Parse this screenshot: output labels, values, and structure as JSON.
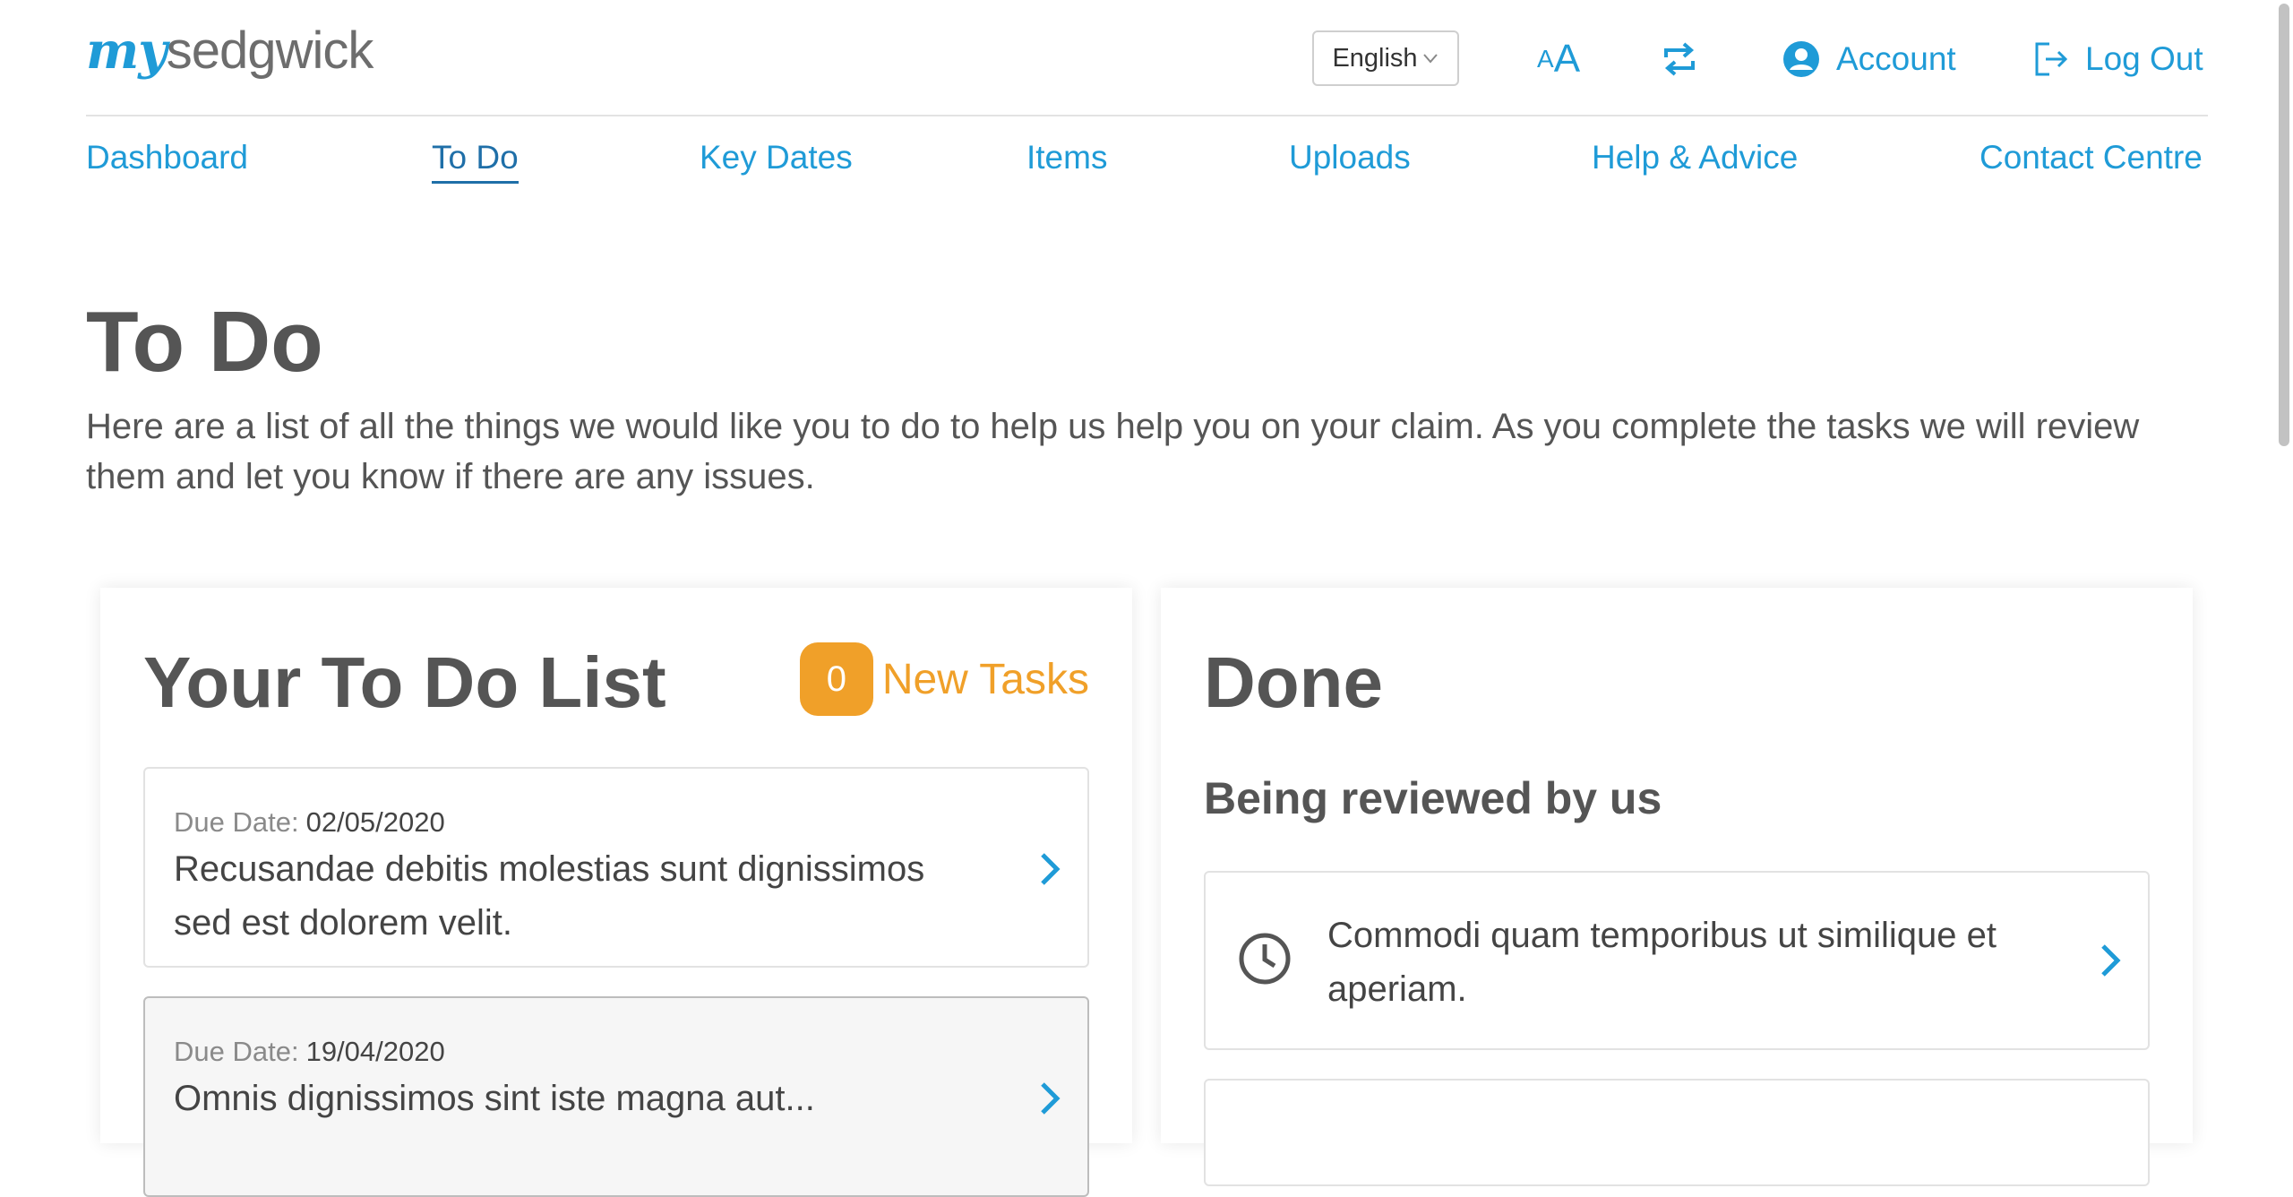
{
  "header": {
    "logo_my": "my",
    "logo_brand": "sedgwick",
    "language": "English",
    "text_size_label": "AA",
    "account_label": "Account",
    "logout_label": "Log Out"
  },
  "nav": {
    "items": [
      {
        "label": "Dashboard"
      },
      {
        "label": "To Do"
      },
      {
        "label": "Key Dates"
      },
      {
        "label": "Items"
      },
      {
        "label": "Uploads"
      },
      {
        "label": "Help & Advice"
      },
      {
        "label": "Contact Centre"
      }
    ],
    "active": "To Do"
  },
  "page": {
    "title": "To Do",
    "intro": "Here are a list of all the things we would like you to do to help us help you on your claim. As you complete the tasks we will review them and let you know if there are any issues."
  },
  "todo": {
    "title": "Your To Do List",
    "new_count": "0",
    "new_label": "New Tasks",
    "due_label": "Due Date:",
    "tasks": [
      {
        "due": "02/05/2020",
        "text": "Recusandae debitis molestias sunt dignissimos sed est dolorem velit."
      },
      {
        "due": "19/04/2020",
        "text": "Omnis dignissimos sint iste magna aut..."
      }
    ]
  },
  "done": {
    "title": "Done",
    "subtitle": "Being reviewed by us",
    "items": [
      {
        "text": "Commodi quam temporibus ut similique et aperiam."
      }
    ]
  },
  "colors": {
    "brand_blue": "#1f9bd7",
    "badge_orange": "#f0a029",
    "text_gray": "#555555"
  }
}
